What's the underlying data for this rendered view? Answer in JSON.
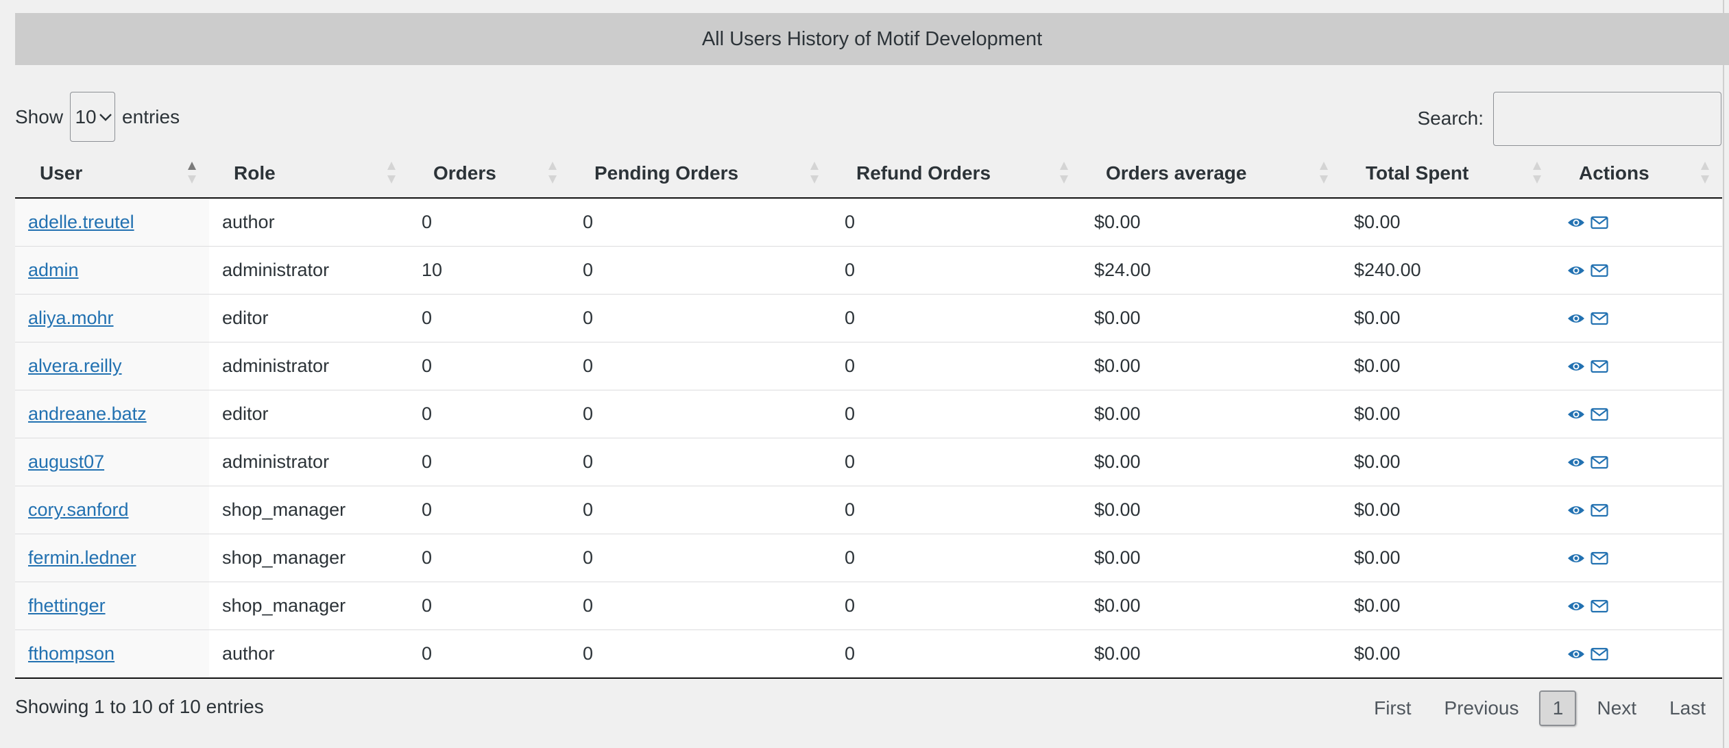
{
  "page": {
    "title": "All Users History of Motif Development"
  },
  "length_control": {
    "show_label": "Show",
    "selected": "10",
    "entries_label": "entries"
  },
  "search": {
    "label": "Search:",
    "value": ""
  },
  "table": {
    "columns": [
      "User",
      "Role",
      "Orders",
      "Pending Orders",
      "Refund Orders",
      "Orders average",
      "Total Spent",
      "Actions"
    ],
    "sorted_column": "User",
    "sort_direction": "ascending",
    "rows": [
      {
        "user": "adelle.treutel",
        "role": "author",
        "orders": "0",
        "pending": "0",
        "refund": "0",
        "average": "$0.00",
        "total": "$0.00"
      },
      {
        "user": "admin",
        "role": "administrator",
        "orders": "10",
        "pending": "0",
        "refund": "0",
        "average": "$24.00",
        "total": "$240.00"
      },
      {
        "user": "aliya.mohr",
        "role": "editor",
        "orders": "0",
        "pending": "0",
        "refund": "0",
        "average": "$0.00",
        "total": "$0.00"
      },
      {
        "user": "alvera.reilly",
        "role": "administrator",
        "orders": "0",
        "pending": "0",
        "refund": "0",
        "average": "$0.00",
        "total": "$0.00"
      },
      {
        "user": "andreane.batz",
        "role": "editor",
        "orders": "0",
        "pending": "0",
        "refund": "0",
        "average": "$0.00",
        "total": "$0.00"
      },
      {
        "user": "august07",
        "role": "administrator",
        "orders": "0",
        "pending": "0",
        "refund": "0",
        "average": "$0.00",
        "total": "$0.00"
      },
      {
        "user": "cory.sanford",
        "role": "shop_manager",
        "orders": "0",
        "pending": "0",
        "refund": "0",
        "average": "$0.00",
        "total": "$0.00"
      },
      {
        "user": "fermin.ledner",
        "role": "shop_manager",
        "orders": "0",
        "pending": "0",
        "refund": "0",
        "average": "$0.00",
        "total": "$0.00"
      },
      {
        "user": "fhettinger",
        "role": "shop_manager",
        "orders": "0",
        "pending": "0",
        "refund": "0",
        "average": "$0.00",
        "total": "$0.00"
      },
      {
        "user": "fthompson",
        "role": "author",
        "orders": "0",
        "pending": "0",
        "refund": "0",
        "average": "$0.00",
        "total": "$0.00"
      }
    ],
    "row_action_icons": [
      "eye-icon",
      "envelope-icon"
    ]
  },
  "footer": {
    "info": "Showing 1 to 10 of 10 entries",
    "pagination": {
      "first": "First",
      "previous": "Previous",
      "current": "1",
      "next": "Next",
      "last": "Last"
    }
  },
  "colors": {
    "link": "#2271b1",
    "title_bar": "#cccccc",
    "background": "#f0f0f0"
  }
}
